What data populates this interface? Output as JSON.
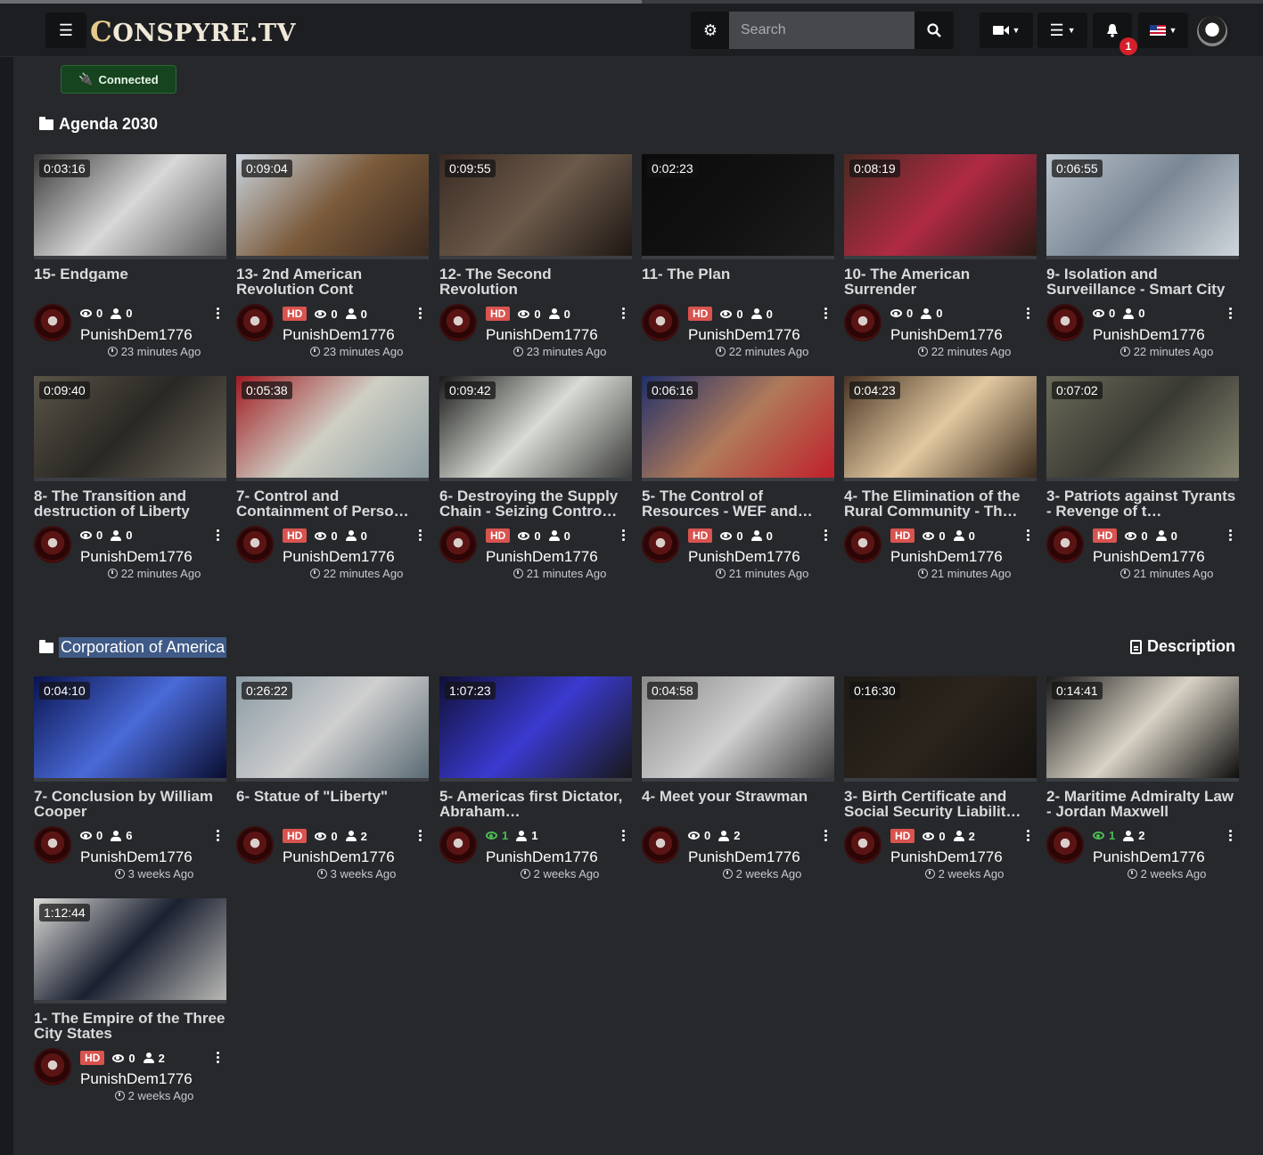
{
  "header": {
    "logo_first": "C",
    "logo_rest": "ONSPYRE.TV",
    "search_placeholder": "Search",
    "notification_count": "1"
  },
  "status": {
    "connected_label": "Connected"
  },
  "sections": [
    {
      "title": "Agenda 2030",
      "videos": [
        {
          "duration": "0:03:16",
          "title": "15- Endgame",
          "hd": false,
          "views": "0",
          "likes": "0",
          "channel": "PunishDem1776",
          "ago": "23 minutes Ago",
          "colors": [
            "#3a3a3a",
            "#d8d8d8",
            "#5a5a5a"
          ]
        },
        {
          "duration": "0:09:04",
          "title": "13- 2nd American Revolution Cont",
          "hd": true,
          "views": "0",
          "likes": "0",
          "channel": "PunishDem1776",
          "ago": "23 minutes Ago",
          "colors": [
            "#c9d3dd",
            "#7a5a3a",
            "#3b2a1f"
          ]
        },
        {
          "duration": "0:09:55",
          "title": "12- The Second Revolution",
          "hd": true,
          "views": "0",
          "likes": "0",
          "channel": "PunishDem1776",
          "ago": "23 minutes Ago",
          "colors": [
            "#3a2a22",
            "#6b5a4a",
            "#1f1713"
          ]
        },
        {
          "duration": "0:02:23",
          "title": "11- The Plan",
          "hd": true,
          "views": "0",
          "likes": "0",
          "channel": "PunishDem1776",
          "ago": "22 minutes Ago",
          "colors": [
            "#0b0b0b",
            "#111111",
            "#1d1d1d"
          ]
        },
        {
          "duration": "0:08:19",
          "title": "10- The American Surrender",
          "hd": false,
          "views": "0",
          "likes": "0",
          "channel": "PunishDem1776",
          "ago": "22 minutes Ago",
          "colors": [
            "#4a2a20",
            "#b02a44",
            "#2b1a14"
          ]
        },
        {
          "duration": "0:06:55",
          "title": "9- Isolation and Surveillance - Smart City",
          "hd": false,
          "views": "0",
          "likes": "0",
          "channel": "PunishDem1776",
          "ago": "22 minutes Ago",
          "colors": [
            "#b8c2cc",
            "#7a8794",
            "#d0d6dc"
          ]
        }
      ]
    },
    {
      "title": "",
      "videos": [
        {
          "duration": "0:09:40",
          "title": "8- The Transition and destruction of Liberty",
          "hd": false,
          "views": "0",
          "likes": "0",
          "channel": "PunishDem1776",
          "ago": "22 minutes Ago",
          "colors": [
            "#5a5448",
            "#2a2824",
            "#6e685c"
          ]
        },
        {
          "duration": "0:05:38",
          "title": "7- Control and Containment of Perso…",
          "hd": true,
          "views": "0",
          "likes": "0",
          "channel": "PunishDem1776",
          "ago": "22 minutes Ago",
          "colors": [
            "#a01c22",
            "#cfcfc4",
            "#8a9aa0"
          ]
        },
        {
          "duration": "0:09:42",
          "title": "6- Destroying the Supply Chain - Seizing Contro…",
          "hd": true,
          "views": "0",
          "likes": "0",
          "channel": "PunishDem1776",
          "ago": "21 minutes Ago",
          "colors": [
            "#1a1a1a",
            "#d8dcd4",
            "#3a3a3a"
          ]
        },
        {
          "duration": "0:06:16",
          "title": "5- The Control of Resources - WEF and…",
          "hd": true,
          "views": "0",
          "likes": "0",
          "channel": "PunishDem1776",
          "ago": "21 minutes Ago",
          "colors": [
            "#20306a",
            "#b07a5a",
            "#c0202a"
          ]
        },
        {
          "duration": "0:04:23",
          "title": "4- The Elimination of the Rural Community - Th…",
          "hd": true,
          "views": "0",
          "likes": "0",
          "channel": "PunishDem1776",
          "ago": "21 minutes Ago",
          "colors": [
            "#4a3424",
            "#e2c8a0",
            "#3a2a1c"
          ]
        },
        {
          "duration": "0:07:02",
          "title": "3- Patriots against Tyrants - Revenge of t…",
          "hd": true,
          "views": "0",
          "likes": "0",
          "channel": "PunishDem1776",
          "ago": "21 minutes Ago",
          "colors": [
            "#6a6a58",
            "#3a3a34",
            "#8a8a74"
          ]
        }
      ]
    },
    {
      "title": "Corporation of America",
      "description_label": "Description",
      "videos": [
        {
          "duration": "0:04:10",
          "title": "7- Conclusion by William Cooper",
          "hd": false,
          "views": "0",
          "likes": "6",
          "viewsGreen": false,
          "channel": "PunishDem1776",
          "ago": "3 weeks Ago",
          "colors": [
            "#0a1450",
            "#4a6ad8",
            "#0a0e30"
          ]
        },
        {
          "duration": "0:26:22",
          "title": "6- Statue of \"Liberty\"",
          "hd": true,
          "views": "0",
          "likes": "2",
          "viewsGreen": false,
          "channel": "PunishDem1776",
          "ago": "3 weeks Ago",
          "colors": [
            "#8a9aa4",
            "#cfcfcf",
            "#5a6a74"
          ]
        },
        {
          "duration": "1:07:23",
          "title": "5- Americas first Dictator, Abraham…",
          "hd": false,
          "views": "1",
          "likes": "1",
          "viewsGreen": true,
          "channel": "PunishDem1776",
          "ago": "2 weeks Ago",
          "colors": [
            "#101038",
            "#3a3ad0",
            "#181818"
          ]
        },
        {
          "duration": "0:04:58",
          "title": "4- Meet your Strawman",
          "hd": false,
          "views": "0",
          "likes": "2",
          "viewsGreen": false,
          "channel": "PunishDem1776",
          "ago": "2 weeks Ago",
          "colors": [
            "#8a8a8a",
            "#d0d0d0",
            "#3a3a3a"
          ]
        },
        {
          "duration": "0:16:30",
          "title": "3- Birth Certificate and Social Security Liabilit…",
          "hd": true,
          "views": "0",
          "likes": "2",
          "viewsGreen": false,
          "channel": "PunishDem1776",
          "ago": "2 weeks Ago",
          "colors": [
            "#1e1a14",
            "#2a241c",
            "#151210"
          ]
        },
        {
          "duration": "0:14:41",
          "title": "2- Maritime Admiralty Law - Jordan Maxwell",
          "hd": false,
          "views": "1",
          "likes": "2",
          "viewsGreen": true,
          "channel": "PunishDem1776",
          "ago": "2 weeks Ago",
          "colors": [
            "#1a1a1a",
            "#d8d2c4",
            "#0e0e0e"
          ]
        }
      ]
    },
    {
      "title": "",
      "videos": [
        {
          "duration": "1:12:44",
          "title": "1- The Empire of the Three City States",
          "hd": true,
          "views": "0",
          "likes": "2",
          "viewsGreen": false,
          "channel": "PunishDem1776",
          "ago": "2 weeks Ago",
          "colors": [
            "#dcdcd8",
            "#1a2030",
            "#b8b8b4"
          ]
        }
      ]
    }
  ]
}
